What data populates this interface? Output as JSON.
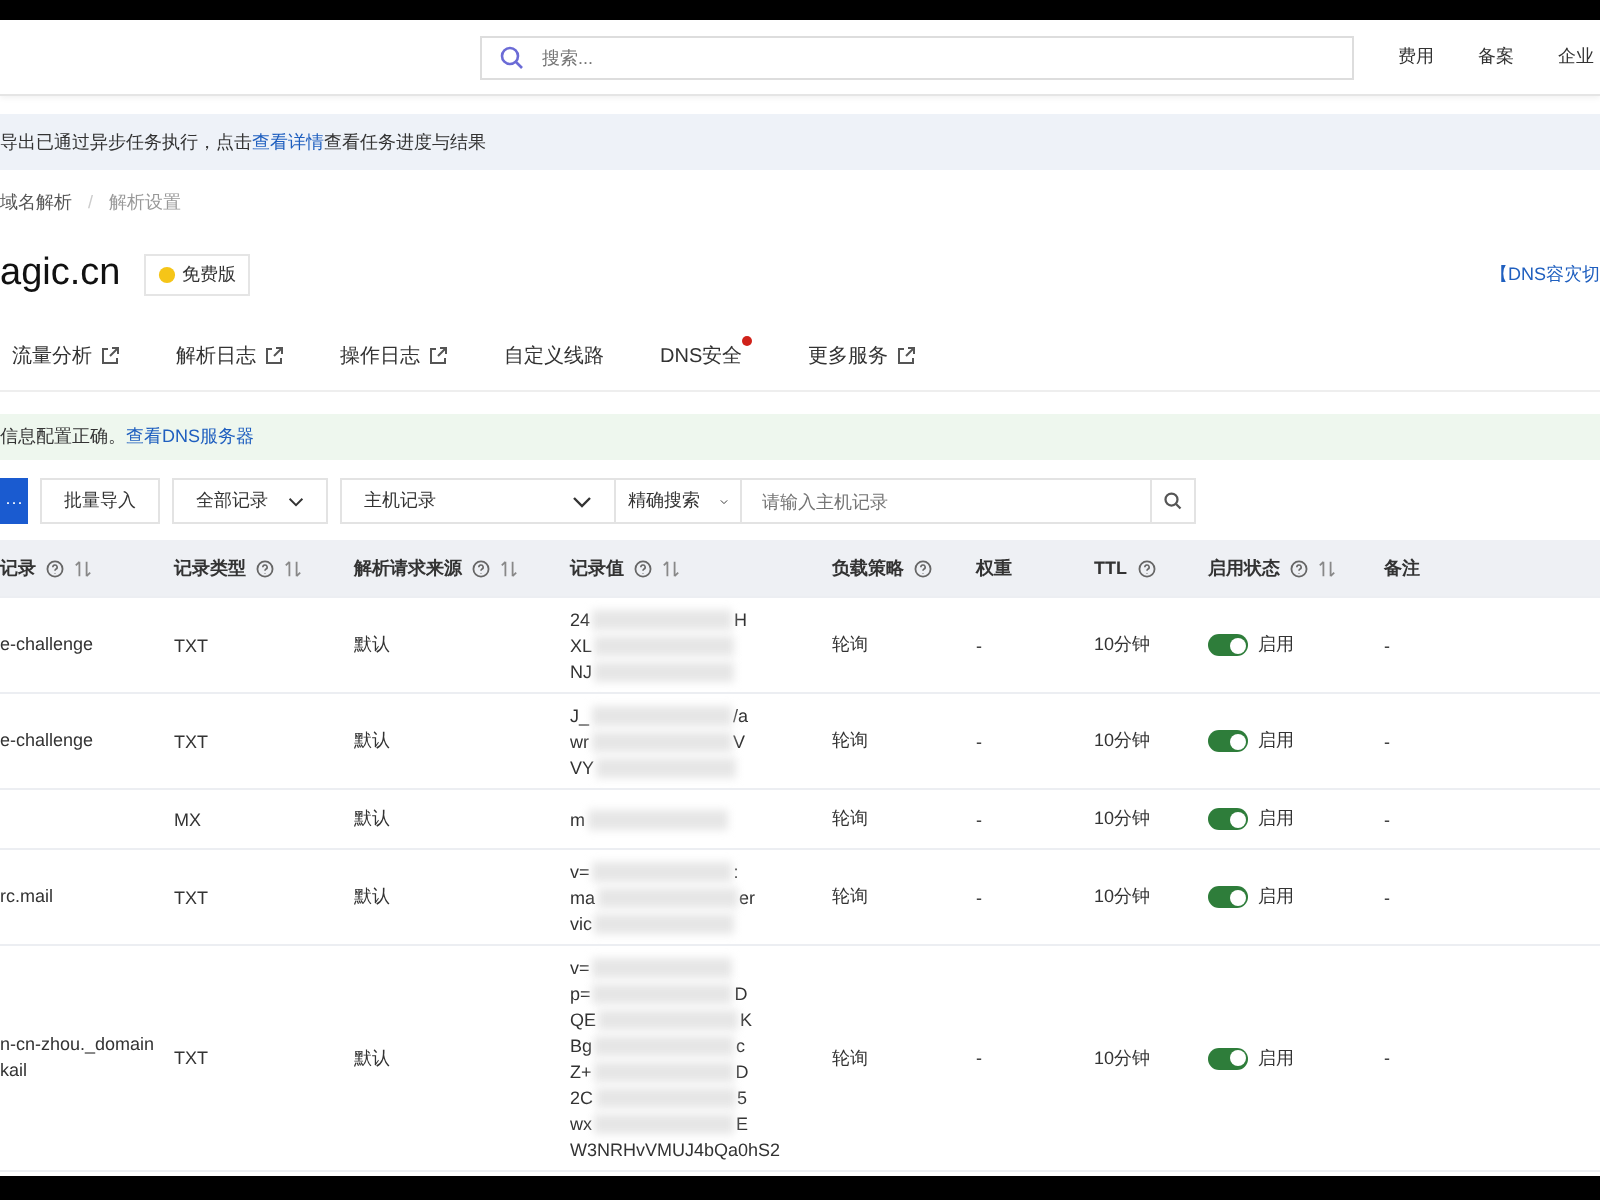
{
  "topbar": {
    "search": {
      "placeholder": "搜索..."
    },
    "links": [
      "费用",
      "备案",
      "企业"
    ]
  },
  "notice": {
    "before": "导出已通过异步任务执行，点击",
    "link": "查看详情",
    "after": "查看任务进度与结果"
  },
  "breadcrumb": {
    "items": [
      "域名解析",
      "解析设置"
    ],
    "separator": "/"
  },
  "domain": {
    "name": "agic.cn",
    "badge": "免费版",
    "right_link": "【DNS容灾切"
  },
  "tabs": [
    {
      "label": "流量分析",
      "external": true,
      "dot": false
    },
    {
      "label": "解析日志",
      "external": true,
      "dot": false
    },
    {
      "label": "操作日志",
      "external": true,
      "dot": false
    },
    {
      "label": "自定义线路",
      "external": false,
      "dot": false
    },
    {
      "label": "DNS安全",
      "external": false,
      "dot": true
    },
    {
      "label": "更多服务",
      "external": true,
      "dot": false
    }
  ],
  "status_notice": {
    "text": "信息配置正确。",
    "link": "查看DNS服务器"
  },
  "toolbar": {
    "more_button": "···",
    "import_button": "批量导入",
    "filter": "全部记录",
    "field": "主机记录",
    "mode": "精确搜索",
    "search": {
      "placeholder": "请输入主机记录"
    }
  },
  "table": {
    "columns": [
      {
        "label": "记录",
        "info": true,
        "sort": true
      },
      {
        "label": "记录类型",
        "info": true,
        "sort": true
      },
      {
        "label": "解析请求来源",
        "info": true,
        "sort": true
      },
      {
        "label": "记录值",
        "info": true,
        "sort": true
      },
      {
        "label": "负载策略",
        "info": true,
        "sort": false
      },
      {
        "label": "权重",
        "info": false,
        "sort": false
      },
      {
        "label": "TTL",
        "info": true,
        "sort": false
      },
      {
        "label": "启用状态",
        "info": true,
        "sort": true
      },
      {
        "label": "备注",
        "info": false,
        "sort": false
      }
    ],
    "rows": [
      {
        "host": "e-challenge",
        "type": "TXT",
        "source": "默认",
        "value": [
          {
            "start": "24",
            "end": "H"
          },
          {
            "start": "XL"
          },
          {
            "start": "NJ"
          }
        ],
        "policy": "轮询",
        "weight": "-",
        "ttl": "10分钟",
        "enabled": true,
        "status": "启用",
        "note": "-"
      },
      {
        "host": "e-challenge",
        "type": "TXT",
        "source": "默认",
        "value": [
          {
            "start": "J_",
            "end": "/a"
          },
          {
            "start": "wr",
            "end": "V"
          },
          {
            "start": "VY"
          }
        ],
        "policy": "轮询",
        "weight": "-",
        "ttl": "10分钟",
        "enabled": true,
        "status": "启用",
        "note": "-"
      },
      {
        "host": "",
        "type": "MX",
        "source": "默认",
        "value": [
          {
            "start": "m"
          }
        ],
        "policy": "轮询",
        "weight": "-",
        "ttl": "10分钟",
        "enabled": true,
        "status": "启用",
        "note": "-"
      },
      {
        "host": "rc.mail",
        "type": "TXT",
        "source": "默认",
        "value": [
          {
            "start": "v=",
            "end": ":"
          },
          {
            "start": "ma",
            "end": "er"
          },
          {
            "start": "vic"
          }
        ],
        "policy": "轮询",
        "weight": "-",
        "ttl": "10分钟",
        "enabled": true,
        "status": "启用",
        "note": "-"
      },
      {
        "host": "n-cn-zhou._domainkail",
        "type": "TXT",
        "source": "默认",
        "value": [
          {
            "start": "v="
          },
          {
            "start": "p=",
            "end": "D"
          },
          {
            "start": "QE",
            "end": "K"
          },
          {
            "start": "Bg",
            "end": "c"
          },
          {
            "start": "Z+",
            "end": "D"
          },
          {
            "start": "2C",
            "end": "5"
          },
          {
            "start": "wx",
            "end": "E"
          },
          {
            "start": "W3NRHvVMUJ4bQa0hS2"
          }
        ],
        "policy": "轮询",
        "weight": "-",
        "ttl": "10分钟",
        "enabled": true,
        "status": "启用",
        "note": "-"
      }
    ]
  }
}
